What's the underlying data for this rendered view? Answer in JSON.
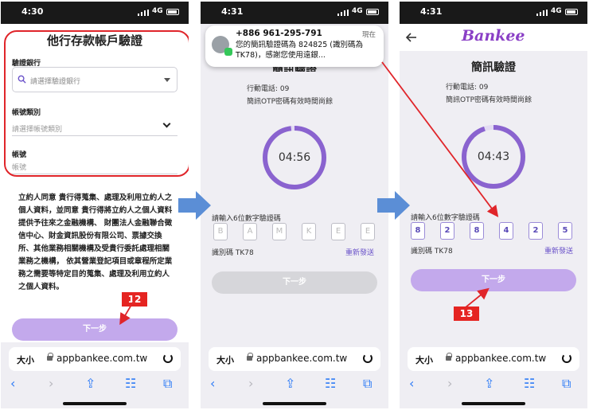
{
  "screens": [
    {
      "status": {
        "time": "4:30",
        "network": "4G"
      },
      "title": "他行存款帳戶驗證",
      "bank_label": "驗證銀行",
      "bank_placeholder": "請選擇驗證銀行",
      "account_type_label": "帳號類別",
      "account_type_placeholder": "請選擇帳號類別",
      "account_label": "帳號",
      "account_placeholder": "帳號",
      "terms": "立約人同意 貴行得蒐集、處理及利用立約人之個人資料，並同意 貴行得將立約人之個人資料提供予往來之金融機構、 財團法人金融聯合徵信中心、財金資訊股份有限公司、票據交換所、其他業務相關機構及受貴行委託處理相關業務之機構， 依其營業登記項目或章程所定業務之需要等特定目的蒐集、處理及利用立約人之個人資料。",
      "next_button": "下一步",
      "badge": "12",
      "browser": {
        "aa": "大小",
        "url": "appbankee.com.tw"
      }
    },
    {
      "status": {
        "time": "4:31",
        "network": "4G"
      },
      "notification": {
        "from": "+886 961-295-791",
        "when": "現在",
        "message": "您的簡訊驗證碼為 824825 (識別碼為 TK78)，感謝您使用遠銀..."
      },
      "title_partial": "簡訊驗證",
      "phone_label": "行動電話: 09",
      "otp_hint": "簡訊OTP密碼有效時間尚餘",
      "timer": "04:56",
      "timer_fraction": 0.98,
      "otp_label": "請輸入6位數字驗證碼",
      "otp_placeholders": [
        "B",
        "A",
        "M",
        "K",
        "E",
        "E"
      ],
      "id_label": "識別碼 TK78",
      "resend": "重新發送",
      "next_button": "下一步",
      "browser": {
        "aa": "大小",
        "url": "appbankee.com.tw"
      }
    },
    {
      "status": {
        "time": "4:31",
        "network": "4G"
      },
      "logo": "Bankee",
      "title": "簡訊驗證",
      "phone_label": "行動電話: 09",
      "otp_hint": "簡訊OTP密碼有效時間尚餘",
      "timer": "04:43",
      "timer_fraction": 0.95,
      "otp_label": "請輸入6位數字驗證碼",
      "otp_digits": [
        "8",
        "2",
        "8",
        "4",
        "2",
        "5"
      ],
      "id_label": "識別碼 TK78",
      "resend": "重新發送",
      "next_button": "下一步",
      "badge": "13",
      "browser": {
        "aa": "大小",
        "url": "appbankee.com.tw"
      }
    }
  ],
  "colors": {
    "accent": "#c3a9ec",
    "ring": "#8a63cf",
    "annotation": "#e0252a",
    "flow_arrow": "#5b8ed6"
  }
}
